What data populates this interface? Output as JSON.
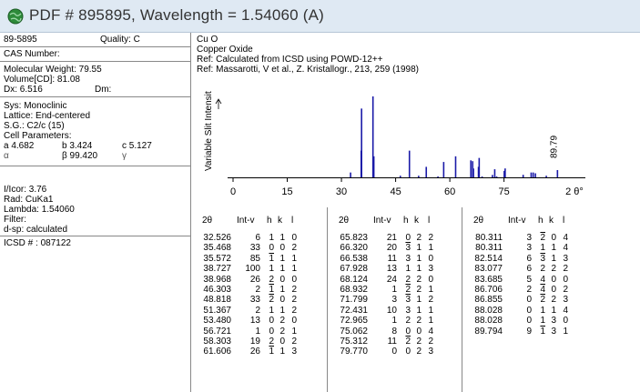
{
  "window": {
    "title": "PDF # 895895,  Wavelength = 1.54060  (A)",
    "icon": "globe-icon"
  },
  "left_panel": {
    "pdf_number": "89-5895",
    "quality": "Quality: C",
    "cas_label": "CAS Number:",
    "molecular_weight": "Molecular Weight:  79.55",
    "volume": "Volume[CD]:  81.08",
    "dx": "Dx:  6.516",
    "dm": "Dm:",
    "sys": "Sys: Monoclinic",
    "lattice": "Lattice: End-centered",
    "sg": "S.G.: C2/c (15)",
    "cell_params": "Cell Parameters:",
    "a": "a  4.682",
    "b": "b  3.424",
    "c": "c  5.127",
    "alpha": "α",
    "beta": "β  99.420",
    "gamma": "γ",
    "icor": "I/Icor:  3.76",
    "rad": "Rad: CuKa1",
    "lambda": "Lambda: 1.54060",
    "filter": "Filter:",
    "dsp": "d-sp: calculated",
    "icsd": "ICSD # : 087122"
  },
  "header": {
    "formula": "Cu O",
    "name": "Copper Oxide",
    "ref1": "Ref:  Calculated from ICSD using POWD-12++",
    "ref2": "Ref: Massarotti, V et al., Z. Kristallogr., 213, 259 (1998)"
  },
  "chart_data": {
    "type": "bar",
    "ylabel": "Variable Slit Intensity",
    "xlabel": "2 θ°",
    "xlim": [
      0,
      95
    ],
    "ylim": [
      0,
      100
    ],
    "xticks": [
      0,
      15,
      30,
      45,
      60,
      75
    ],
    "annotation": "89.79",
    "bars": [
      {
        "x": 32.526,
        "y": 6
      },
      {
        "x": 35.468,
        "y": 33
      },
      {
        "x": 35.572,
        "y": 85
      },
      {
        "x": 38.727,
        "y": 100
      },
      {
        "x": 38.968,
        "y": 26
      },
      {
        "x": 46.303,
        "y": 2
      },
      {
        "x": 48.818,
        "y": 33
      },
      {
        "x": 51.367,
        "y": 2
      },
      {
        "x": 53.48,
        "y": 13
      },
      {
        "x": 56.721,
        "y": 1
      },
      {
        "x": 58.303,
        "y": 19
      },
      {
        "x": 61.606,
        "y": 26
      },
      {
        "x": 65.823,
        "y": 21
      },
      {
        "x": 66.32,
        "y": 20
      },
      {
        "x": 66.538,
        "y": 11
      },
      {
        "x": 67.928,
        "y": 13
      },
      {
        "x": 68.124,
        "y": 24
      },
      {
        "x": 68.932,
        "y": 1
      },
      {
        "x": 71.799,
        "y": 3
      },
      {
        "x": 72.431,
        "y": 10
      },
      {
        "x": 72.965,
        "y": 1
      },
      {
        "x": 75.062,
        "y": 8
      },
      {
        "x": 75.312,
        "y": 11
      },
      {
        "x": 79.77,
        "y": 0
      },
      {
        "x": 80.311,
        "y": 3
      },
      {
        "x": 80.311,
        "y": 3
      },
      {
        "x": 82.514,
        "y": 6
      },
      {
        "x": 83.077,
        "y": 6
      },
      {
        "x": 83.685,
        "y": 5
      },
      {
        "x": 86.706,
        "y": 2
      },
      {
        "x": 86.855,
        "y": 0
      },
      {
        "x": 88.028,
        "y": 0
      },
      {
        "x": 88.028,
        "y": 0
      },
      {
        "x": 89.794,
        "y": 9
      }
    ]
  },
  "table": {
    "headers": {
      "theta": "2θ",
      "int": "Int-v",
      "h": "h",
      "k": "k",
      "l": "l"
    },
    "columns": [
      [
        {
          "t": "32.526",
          "i": "6",
          "h": "1",
          "hb": false,
          "k": "1",
          "kb": false,
          "l": "0"
        },
        {
          "t": "35.468",
          "i": "33",
          "h": "0",
          "hb": false,
          "k": "0",
          "kb": false,
          "l": "2"
        },
        {
          "t": "35.572",
          "i": "85",
          "h": "1",
          "hb": true,
          "k": "1",
          "kb": false,
          "l": "1"
        },
        {
          "t": "38.727",
          "i": "100",
          "h": "1",
          "hb": false,
          "k": "1",
          "kb": false,
          "l": "1"
        },
        {
          "t": "38.968",
          "i": "26",
          "h": "2",
          "hb": false,
          "k": "0",
          "kb": false,
          "l": "0"
        },
        {
          "t": "46.303",
          "i": "2",
          "h": "1",
          "hb": true,
          "k": "1",
          "kb": false,
          "l": "2"
        },
        {
          "t": "48.818",
          "i": "33",
          "h": "2",
          "hb": true,
          "k": "0",
          "kb": false,
          "l": "2"
        },
        {
          "t": "51.367",
          "i": "2",
          "h": "1",
          "hb": false,
          "k": "1",
          "kb": false,
          "l": "2"
        },
        {
          "t": "53.480",
          "i": "13",
          "h": "0",
          "hb": false,
          "k": "2",
          "kb": false,
          "l": "0"
        },
        {
          "t": "56.721",
          "i": "1",
          "h": "0",
          "hb": false,
          "k": "2",
          "kb": false,
          "l": "1"
        },
        {
          "t": "58.303",
          "i": "19",
          "h": "2",
          "hb": false,
          "k": "0",
          "kb": false,
          "l": "2"
        },
        {
          "t": "61.606",
          "i": "26",
          "h": "1",
          "hb": true,
          "k": "1",
          "kb": false,
          "l": "3"
        }
      ],
      [
        {
          "t": "65.823",
          "i": "21",
          "h": "0",
          "hb": false,
          "k": "2",
          "kb": false,
          "l": "2"
        },
        {
          "t": "66.320",
          "i": "20",
          "h": "3",
          "hb": true,
          "k": "1",
          "kb": false,
          "l": "1"
        },
        {
          "t": "66.538",
          "i": "11",
          "h": "3",
          "hb": false,
          "k": "1",
          "kb": false,
          "l": "0"
        },
        {
          "t": "67.928",
          "i": "13",
          "h": "1",
          "hb": false,
          "k": "1",
          "kb": false,
          "l": "3"
        },
        {
          "t": "68.124",
          "i": "24",
          "h": "2",
          "hb": false,
          "k": "2",
          "kb": false,
          "l": "0"
        },
        {
          "t": "68.932",
          "i": "1",
          "h": "2",
          "hb": true,
          "k": "2",
          "kb": false,
          "l": "1"
        },
        {
          "t": "71.799",
          "i": "3",
          "h": "3",
          "hb": true,
          "k": "1",
          "kb": false,
          "l": "2"
        },
        {
          "t": "72.431",
          "i": "10",
          "h": "3",
          "hb": false,
          "k": "1",
          "kb": false,
          "l": "1"
        },
        {
          "t": "72.965",
          "i": "1",
          "h": "2",
          "hb": false,
          "k": "2",
          "kb": false,
          "l": "1"
        },
        {
          "t": "75.062",
          "i": "8",
          "h": "0",
          "hb": false,
          "k": "0",
          "kb": false,
          "l": "4"
        },
        {
          "t": "75.312",
          "i": "11",
          "h": "2",
          "hb": true,
          "k": "2",
          "kb": false,
          "l": "2"
        },
        {
          "t": "79.770",
          "i": "0",
          "h": "0",
          "hb": false,
          "k": "2",
          "kb": false,
          "l": "3"
        }
      ],
      [
        {
          "t": "80.311",
          "i": "3",
          "h": "2",
          "hb": true,
          "k": "0",
          "kb": false,
          "l": "4"
        },
        {
          "t": "80.311",
          "i": "3",
          "h": "1",
          "hb": false,
          "k": "1",
          "kb": false,
          "l": "4"
        },
        {
          "t": "82.514",
          "i": "6",
          "h": "3",
          "hb": true,
          "k": "1",
          "kb": false,
          "l": "3"
        },
        {
          "t": "83.077",
          "i": "6",
          "h": "2",
          "hb": false,
          "k": "2",
          "kb": false,
          "l": "2"
        },
        {
          "t": "83.685",
          "i": "5",
          "h": "4",
          "hb": false,
          "k": "0",
          "kb": false,
          "l": "0"
        },
        {
          "t": "86.706",
          "i": "2",
          "h": "4",
          "hb": true,
          "k": "0",
          "kb": false,
          "l": "2"
        },
        {
          "t": "86.855",
          "i": "0",
          "h": "2",
          "hb": true,
          "k": "2",
          "kb": false,
          "l": "3"
        },
        {
          "t": "88.028",
          "i": "0",
          "h": "1",
          "hb": false,
          "k": "1",
          "kb": false,
          "l": "4"
        },
        {
          "t": "88.028",
          "i": "0",
          "h": "1",
          "hb": false,
          "k": "3",
          "kb": false,
          "l": "0"
        },
        {
          "t": "89.794",
          "i": "9",
          "h": "1",
          "hb": true,
          "k": "3",
          "kb": false,
          "l": "1"
        }
      ]
    ]
  },
  "colors": {
    "bar": "#1a1aa8",
    "text": "#000000",
    "title": "#333333",
    "titlebar": "#dfe9f3"
  }
}
